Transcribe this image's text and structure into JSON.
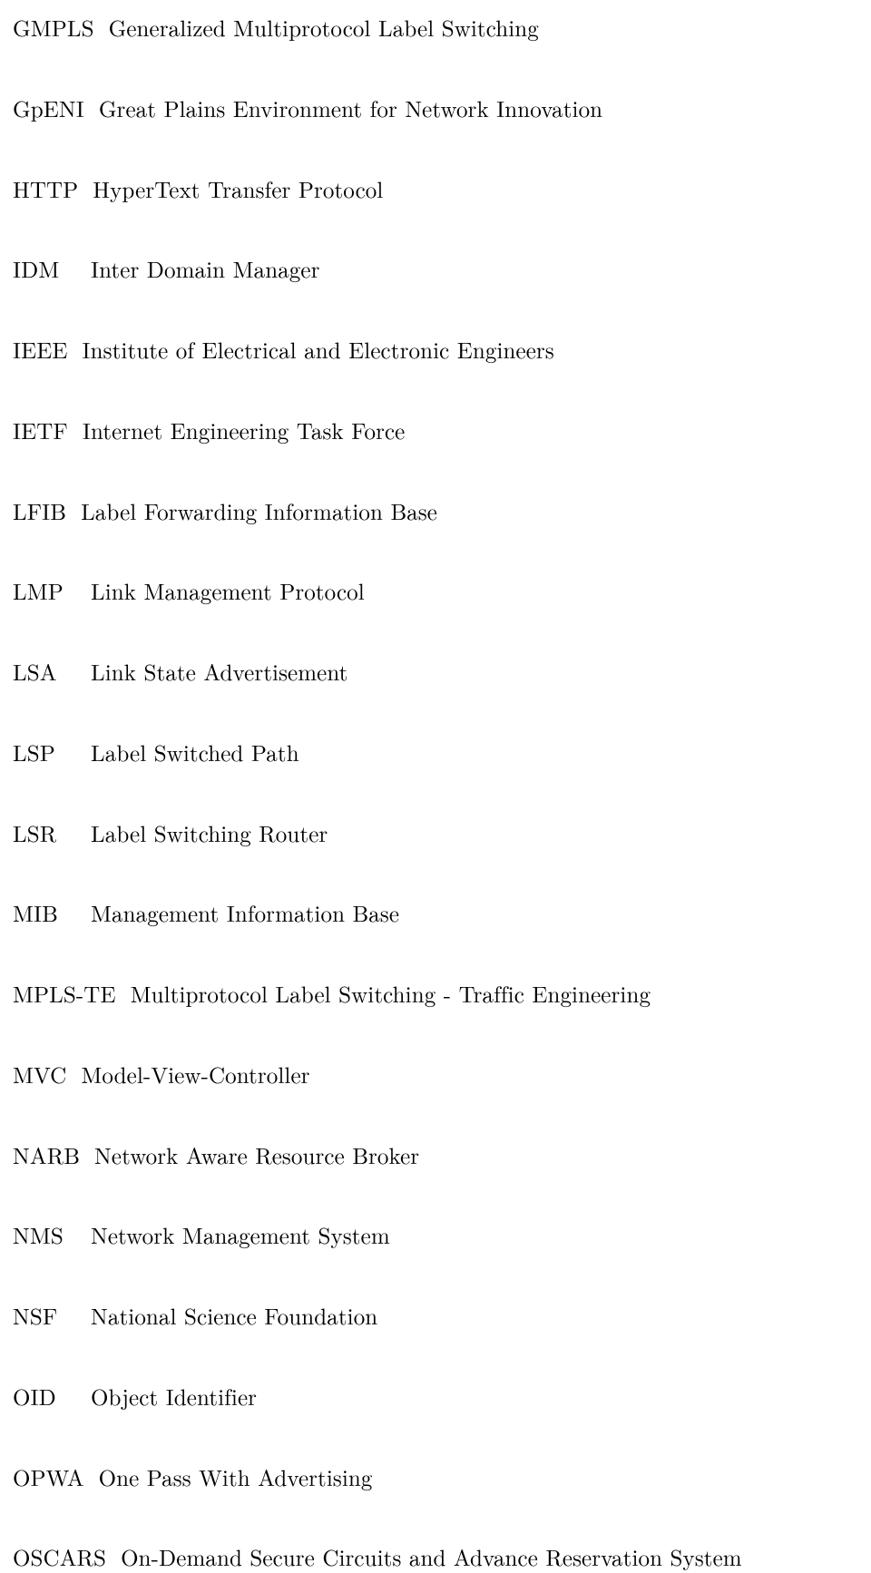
{
  "entries": [
    {
      "abbr": "GMPLS",
      "def": "Generalized Multiprotocol Label Switching"
    },
    {
      "abbr": "GpENI",
      "def": "Great Plains Environment for Network Innovation"
    },
    {
      "abbr": "HTTP",
      "def": "HyperText Transfer Protocol"
    },
    {
      "abbr": "IDM",
      "def": "Inter Domain Manager"
    },
    {
      "abbr": "IEEE",
      "def": "Institute of Electrical and Electronic Engineers"
    },
    {
      "abbr": "IETF",
      "def": "Internet Engineering Task Force"
    },
    {
      "abbr": "LFIB",
      "def": "Label Forwarding Information Base"
    },
    {
      "abbr": "LMP",
      "def": "Link Management Protocol"
    },
    {
      "abbr": "LSA",
      "def": "Link State Advertisement"
    },
    {
      "abbr": "LSP",
      "def": "Label Switched Path"
    },
    {
      "abbr": "LSR",
      "def": "Label Switching Router"
    },
    {
      "abbr": "MIB",
      "def": "Management Information Base"
    },
    {
      "abbr": "MPLS-TE",
      "def": "Multiprotocol Label Switching - Traffic Engineering"
    },
    {
      "abbr": "MVC",
      "def": "Model-View-Controller"
    },
    {
      "abbr": "NARB",
      "def": "Network Aware Resource Broker"
    },
    {
      "abbr": "NMS",
      "def": "Network Management System"
    },
    {
      "abbr": "NSF",
      "def": "National Science Foundation"
    },
    {
      "abbr": "OID",
      "def": "Object Identifier"
    },
    {
      "abbr": "OPWA",
      "def": "One Pass With Advertising"
    },
    {
      "abbr": "OSCARS",
      "def": "On-Demand Secure Circuits and Advance Reservation System"
    }
  ]
}
